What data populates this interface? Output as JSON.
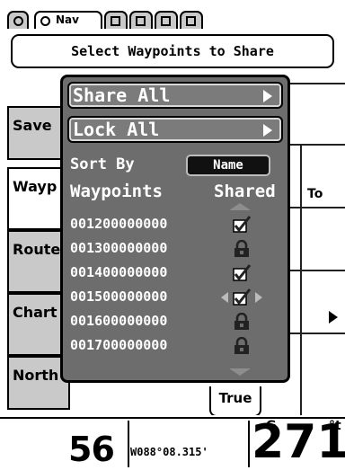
{
  "tabs": [
    {
      "label": "Nav",
      "icon": "compass-icon"
    },
    {
      "label": "",
      "icon": "chart-icon"
    },
    {
      "label": "",
      "icon": "sonar-icon"
    },
    {
      "label": "",
      "icon": "waypoint-icon"
    },
    {
      "label": "",
      "icon": "settings-icon"
    }
  ],
  "sidebar": {
    "items": [
      {
        "label": "Save"
      },
      {
        "label": "Wayp"
      },
      {
        "label": "Route"
      },
      {
        "label": "Chart"
      },
      {
        "label": "North"
      }
    ]
  },
  "background_labels": {
    "to_label": "To"
  },
  "dialog": {
    "title": "Select Waypoints to Share",
    "share_all": "Share All",
    "lock_all": "Lock All",
    "sort_by_label": "Sort By",
    "sort_value": "Name",
    "col_waypoints": "Waypoints",
    "col_shared": "Shared",
    "rows": [
      {
        "name": "001200000000",
        "state": "shared"
      },
      {
        "name": "001300000000",
        "state": "locked"
      },
      {
        "name": "001400000000",
        "state": "shared"
      },
      {
        "name": "001500000000",
        "state": "shared"
      },
      {
        "name": "001600000000",
        "state": "locked"
      },
      {
        "name": "001700000000",
        "state": "locked"
      }
    ]
  },
  "footer_tab": {
    "label": "True"
  },
  "status": {
    "speed_value": "56",
    "coordinate": "W088°08.315'",
    "heading_value": "271",
    "unit_left": "G",
    "unit_right": "°t"
  },
  "colors": {
    "dialog_bg": "#6d6d6d",
    "accent_white": "#ffffff",
    "frame_gray": "#c9c9c9"
  }
}
